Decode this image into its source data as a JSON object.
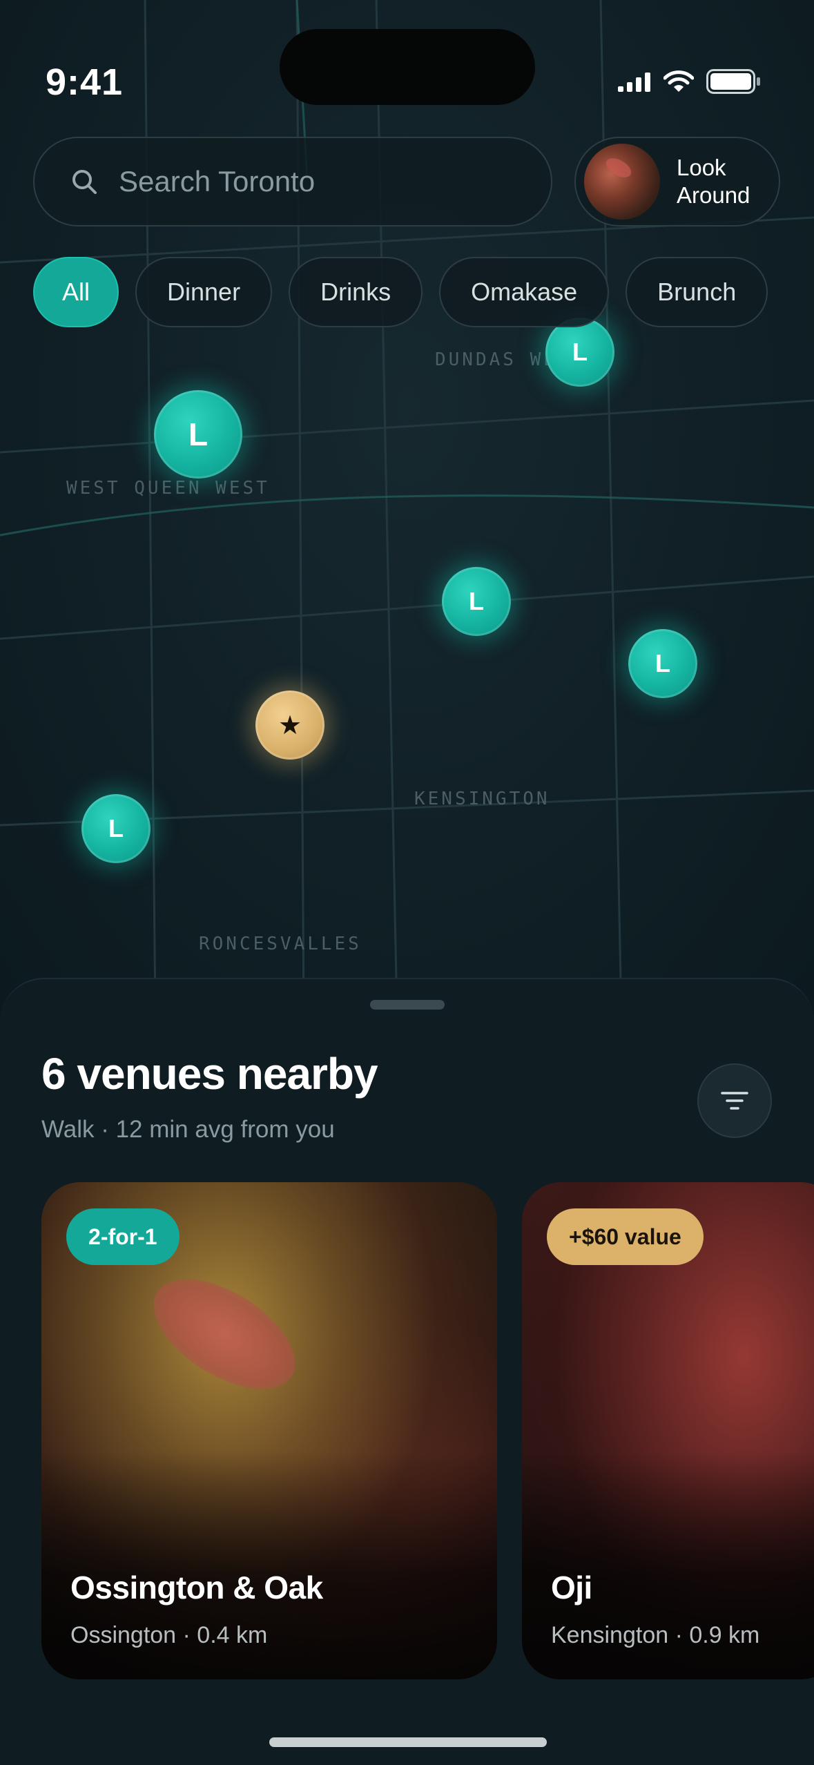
{
  "status_bar": {
    "time": "9:41"
  },
  "search": {
    "placeholder": "Search Toronto"
  },
  "look_around": {
    "label_line1": "Look",
    "label_line2": "Around"
  },
  "filters": [
    {
      "label": "All",
      "active": true
    },
    {
      "label": "Dinner",
      "active": false
    },
    {
      "label": "Drinks",
      "active": false
    },
    {
      "label": "Omakase",
      "active": false
    },
    {
      "label": "Brunch",
      "active": false
    }
  ],
  "map": {
    "neighborhoods": [
      "DUNDAS WEST",
      "WEST QUEEN WEST",
      "KENSINGTON",
      "RONCESVALLES"
    ],
    "pin_letter": "L",
    "pin_star": "★"
  },
  "sheet": {
    "title": "6 venues nearby",
    "subtitle": "Walk · 12 min avg from you"
  },
  "venues": [
    {
      "badge": "2-for-1",
      "name": "Ossington & Oak",
      "meta": "Ossington · 0.4 km"
    },
    {
      "badge": "+$60 value",
      "name": "Oji",
      "meta": "Kensington · 0.9 km"
    }
  ],
  "colors": {
    "accent_teal": "#14a899",
    "accent_gold": "#dcb26a",
    "background": "#0d1b21"
  }
}
